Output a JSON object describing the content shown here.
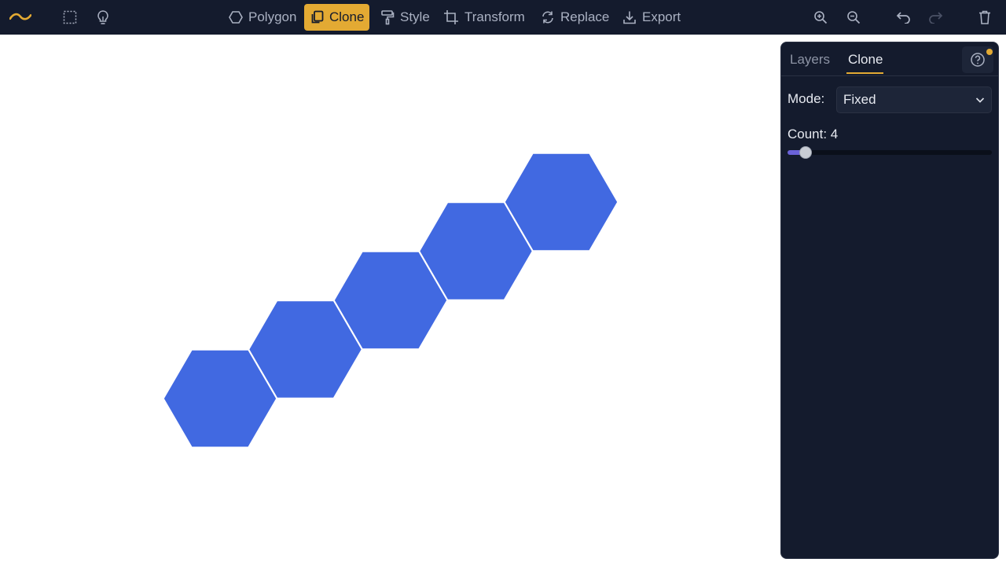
{
  "toolbar": {
    "tools": [
      {
        "label": "Polygon",
        "icon": "hexagon-icon"
      },
      {
        "label": "Clone",
        "icon": "clone-icon",
        "active": true
      },
      {
        "label": "Style",
        "icon": "paint-roller-icon"
      },
      {
        "label": "Transform",
        "icon": "crop-icon"
      },
      {
        "label": "Replace",
        "icon": "replace-icon"
      },
      {
        "label": "Export",
        "icon": "download-icon"
      }
    ],
    "left_icons": [
      "logo-icon",
      "select-region-icon",
      "lightbulb-icon"
    ],
    "right_icons": [
      "zoom-in-icon",
      "zoom-out-icon",
      "undo-icon",
      "redo-icon",
      "trash-icon"
    ]
  },
  "panel": {
    "tabs": [
      {
        "label": "Layers",
        "active": false
      },
      {
        "label": "Clone",
        "active": true
      }
    ],
    "help_icon": "help-icon",
    "mode_label": "Mode:",
    "mode_value": "Fixed",
    "count_label": "Count: 4",
    "count_slider_fraction": 0.06
  },
  "canvas": {
    "shape": "hexagon",
    "copies": 5,
    "fill_color": "#4169e1"
  },
  "colors": {
    "toolbar_bg": "#141b2d",
    "accent": "#e3aa33",
    "panel_bg": "#141b2d"
  }
}
